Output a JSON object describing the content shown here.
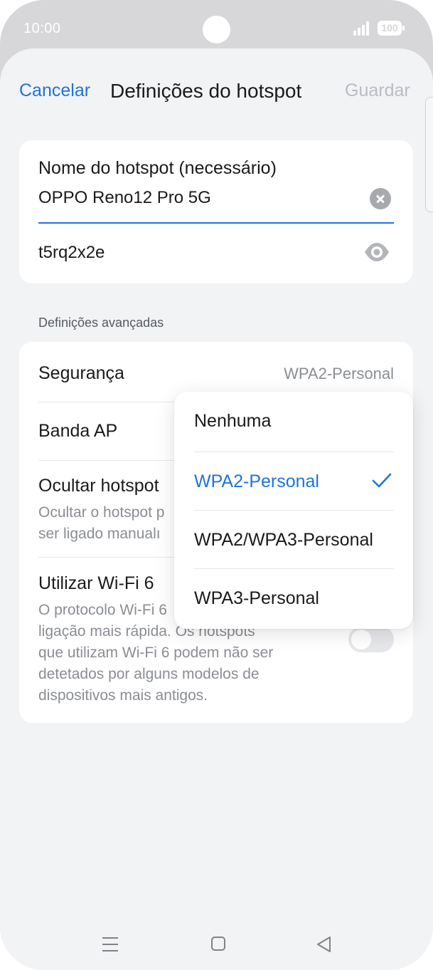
{
  "status_bar": {
    "time": "10:00",
    "battery": "100",
    "icons": [
      "camera-cutout",
      "signal-icon",
      "battery-icon"
    ]
  },
  "header": {
    "cancel_label": "Cancelar",
    "title": "Definições do hotspot",
    "save_label": "Guardar"
  },
  "hotspot": {
    "name_label": "Nome do hotspot (necessário)",
    "name_value": "OPPO Reno12 Pro 5G",
    "password_value": "t5rq2x2e",
    "icons": [
      "clear-icon",
      "eye-icon"
    ]
  },
  "advanced": {
    "section_title": "Definições avançadas",
    "security_label": "Segurança",
    "security_value": "WPA2-Personal",
    "band_label": "Banda AP",
    "hide_label": "Ocultar hotspot",
    "hide_desc_1": "Ocultar o hotspot p",
    "hide_desc_2": "ser ligado manualı",
    "wifi6_label": "Utilizar Wi-Fi 6",
    "wifi6_desc_1": "O protocolo Wi-Fi 6",
    "wifi6_desc_2": "ligação mais rápida. Os hotspots",
    "wifi6_desc_3": "que utilizam Wi-Fi 6 podem não ser",
    "wifi6_desc_4": "detetados por alguns modelos de",
    "wifi6_desc_5": "dispositivos mais antigos.",
    "wifi6_enabled": false
  },
  "security_menu": {
    "options": [
      "Nenhuma",
      "WPA2-Personal",
      "WPA2/WPA3-Personal",
      "WPA3-Personal"
    ],
    "selected": "WPA2-Personal"
  },
  "nav_bar": {
    "icons": [
      "menu-icon",
      "home-icon",
      "back-icon"
    ]
  },
  "colors": {
    "accent": "#1f73dc",
    "background": "#f2f3f5",
    "frame": "#d7d7d9",
    "disabled": "#b9bcc2"
  }
}
